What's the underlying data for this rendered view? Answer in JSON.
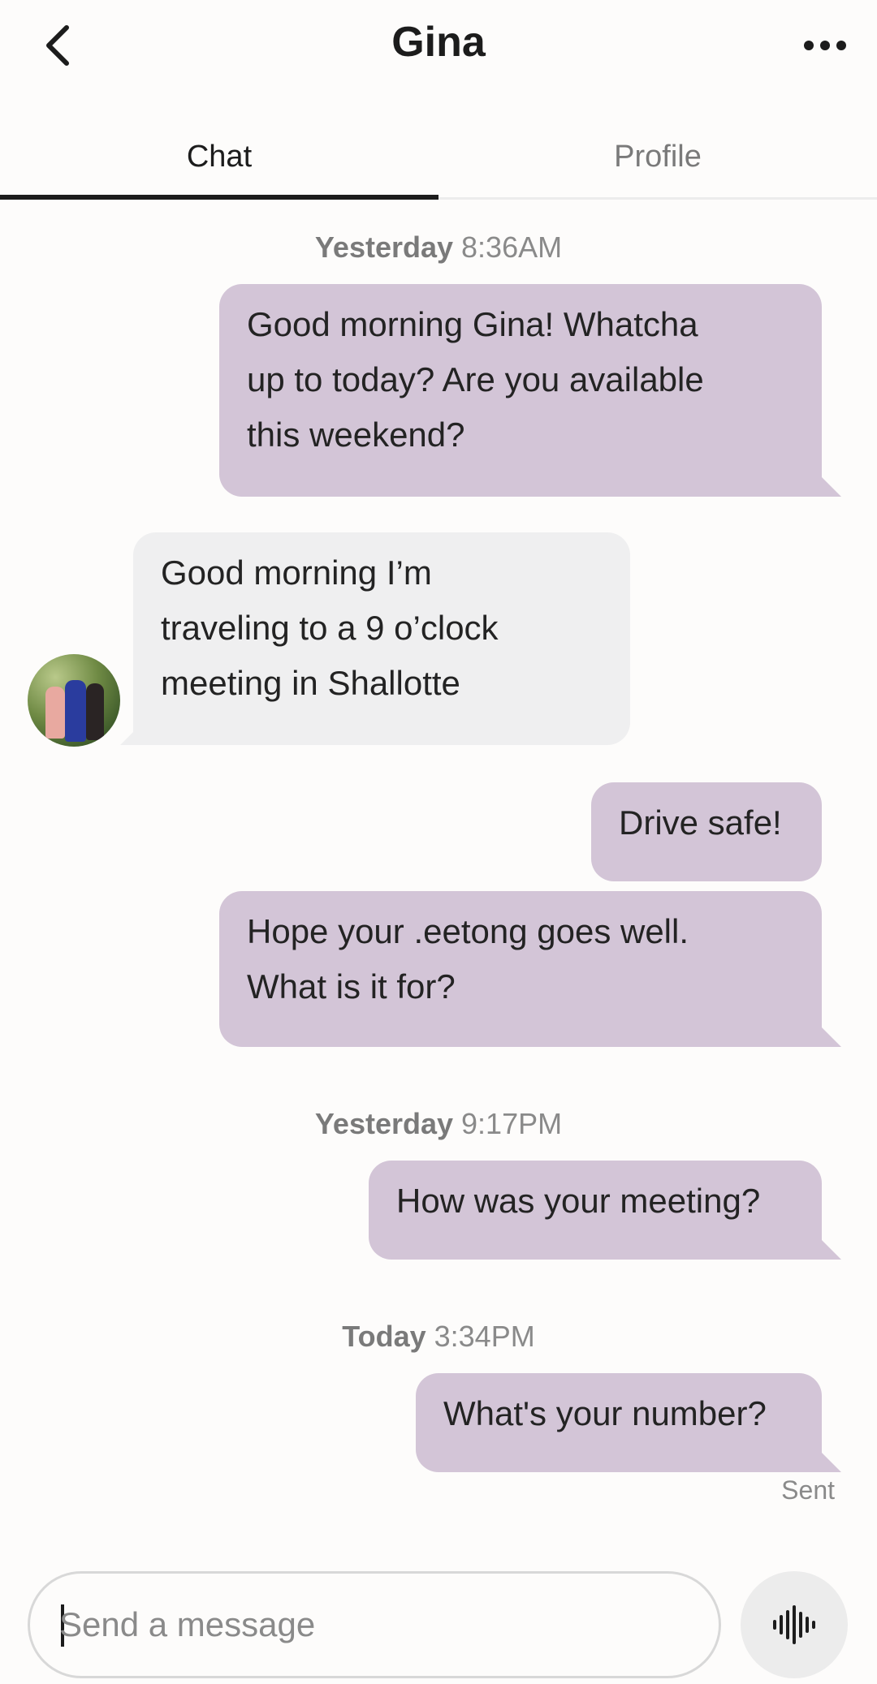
{
  "header": {
    "title": "Gina",
    "back_icon": "chevron-left-icon",
    "more_icon": "more-horizontal-icon"
  },
  "tabs": [
    {
      "label": "Chat",
      "active": true
    },
    {
      "label": "Profile",
      "active": false
    }
  ],
  "conversation": {
    "timestamps": [
      {
        "day": "Yesterday",
        "time": "8:36AM"
      },
      {
        "day": "Yesterday",
        "time": "9:17PM"
      },
      {
        "day": "Today",
        "time": "3:34PM"
      }
    ],
    "messages": [
      {
        "direction": "outgoing",
        "text": "Good morning Gina!  Whatcha\nup to today?  Are you available\nthis weekend?"
      },
      {
        "direction": "incoming",
        "text": "Good morning I’m\ntraveling to a 9 o’clock\nmeeting in Shallotte"
      },
      {
        "direction": "outgoing",
        "text": "Drive safe!"
      },
      {
        "direction": "outgoing",
        "text": "Hope your .eetong goes well.\nWhat is it for?"
      },
      {
        "direction": "outgoing",
        "text": "How was your meeting?"
      },
      {
        "direction": "outgoing",
        "text": "What's your number?"
      }
    ],
    "delivery_status": "Sent"
  },
  "composer": {
    "placeholder": "Send a message",
    "value": "",
    "voice_icon": "voice-waveform-icon"
  },
  "colors": {
    "outgoing_bubble": "#d3c5d7",
    "incoming_bubble": "#efeff0",
    "active_tab_indicator": "#1c1c1c"
  }
}
